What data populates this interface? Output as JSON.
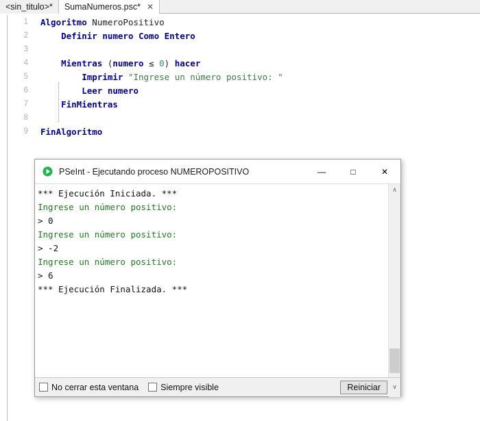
{
  "tabs": [
    {
      "label": "<sin_titulo>*",
      "active": false,
      "closable": false
    },
    {
      "label": "SumaNumeros.psc*",
      "active": true,
      "closable": true,
      "close_glyph": "✕"
    }
  ],
  "editor": {
    "lines": [
      {
        "num": "1",
        "tokens": [
          {
            "t": "kw",
            "v": "Algoritmo"
          },
          {
            "t": "pln",
            "v": " "
          },
          {
            "t": "id",
            "v": "NumeroPositivo"
          }
        ]
      },
      {
        "num": "2",
        "tokens": [
          {
            "t": "pln",
            "v": "    "
          },
          {
            "t": "kw",
            "v": "Definir numero Como Entero"
          }
        ]
      },
      {
        "num": "3",
        "tokens": []
      },
      {
        "num": "4",
        "tokens": [
          {
            "t": "pln",
            "v": "    "
          },
          {
            "t": "kw",
            "v": "Mientras"
          },
          {
            "t": "pln",
            "v": " ("
          },
          {
            "t": "kw",
            "v": "numero"
          },
          {
            "t": "pln",
            "v": " ≤ "
          },
          {
            "t": "num",
            "v": "0"
          },
          {
            "t": "pln",
            "v": ") "
          },
          {
            "t": "kw",
            "v": "hacer"
          }
        ]
      },
      {
        "num": "5",
        "tokens": [
          {
            "t": "pln",
            "v": "        "
          },
          {
            "t": "kw",
            "v": "Imprimir"
          },
          {
            "t": "pln",
            "v": " "
          },
          {
            "t": "str",
            "v": "\"Ingrese un número positivo: \""
          }
        ]
      },
      {
        "num": "6",
        "tokens": [
          {
            "t": "pln",
            "v": "        "
          },
          {
            "t": "kw",
            "v": "Leer numero"
          }
        ]
      },
      {
        "num": "7",
        "tokens": [
          {
            "t": "pln",
            "v": "    "
          },
          {
            "t": "kw",
            "v": "FinMientras"
          }
        ]
      },
      {
        "num": "8",
        "tokens": []
      },
      {
        "num": "9",
        "tokens": [
          {
            "t": "kw",
            "v": "FinAlgoritmo"
          }
        ]
      }
    ]
  },
  "dialog": {
    "icon_name": "pseint-play-icon",
    "title": "PSeInt - Ejecutando proceso NUMEROPOSITIVO",
    "window_controls": [
      {
        "name": "minimize-button",
        "glyph": "—"
      },
      {
        "name": "maximize-button",
        "glyph": "□"
      },
      {
        "name": "close-button",
        "glyph": "✕"
      }
    ],
    "console_lines": [
      {
        "cls": "c-sys",
        "text": "*** Ejecución Iniciada. ***"
      },
      {
        "cls": "c-out",
        "text": "Ingrese un número positivo:"
      },
      {
        "cls": "c-in",
        "text": "> 0"
      },
      {
        "cls": "c-out",
        "text": "Ingrese un número positivo:"
      },
      {
        "cls": "c-in",
        "text": "> -2"
      },
      {
        "cls": "c-out",
        "text": "Ingrese un número positivo:"
      },
      {
        "cls": "c-in",
        "text": "> 6"
      },
      {
        "cls": "c-sys",
        "text": "*** Ejecución Finalizada. ***"
      }
    ],
    "scrollbar": {
      "up_glyph": "∧",
      "down_glyph": "∨"
    },
    "footer": {
      "checkboxes": [
        {
          "label": "No cerrar esta ventana",
          "checked": false
        },
        {
          "label": "Siempre visible",
          "checked": false
        }
      ],
      "restart_label": "Reiniciar",
      "chevron_glyph": "∨"
    }
  },
  "colors": {
    "keyword": "#00008b",
    "string": "#3a7d44",
    "number": "#2c8c7e",
    "console_out": "#1f7a1f",
    "accent_green": "#22b14c"
  }
}
